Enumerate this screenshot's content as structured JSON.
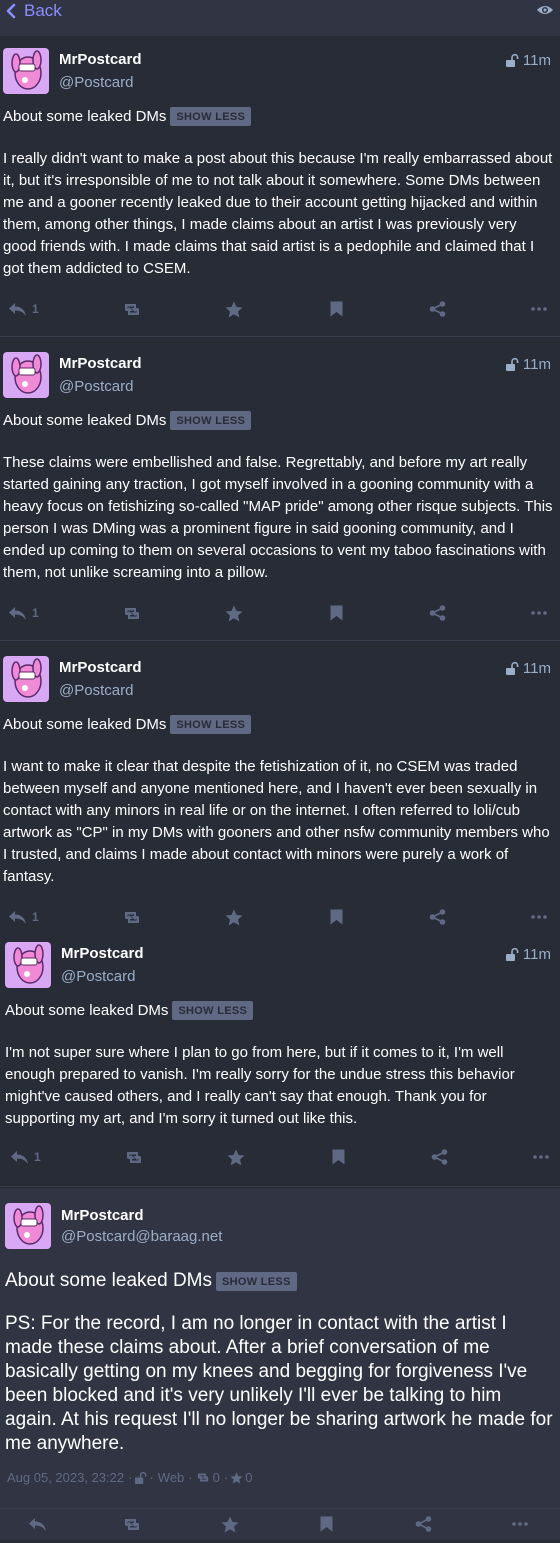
{
  "header": {
    "back_label": "Back"
  },
  "posts": [
    {
      "display_name": "MrPostcard",
      "acct": "@Postcard",
      "time": "11m",
      "cw": "About some leaked DMs",
      "show_less": "SHOW LESS",
      "content": "I really didn't want to make a post about this because I'm really embarrassed about it, but it's irresponsible of me to not talk about it somewhere. Some DMs between me and a gooner recently leaked due to their account getting hijacked and within them, among other things, I made claims about an artist I was previously very good friends with. I made claims that said artist is a pedophile and claimed that I got them addicted to CSEM.",
      "reply_count": "1"
    },
    {
      "display_name": "MrPostcard",
      "acct": "@Postcard",
      "time": "11m",
      "cw": "About some leaked DMs",
      "show_less": "SHOW LESS",
      "content": "These claims were embellished and false. Regrettably, and before my art really started gaining any traction, I got myself involved in a gooning community with a heavy focus on fetishizing so-called \"MAP pride\" among other risque subjects. This person I was DMing was a prominent figure in said gooning community, and I ended up coming to them on several occasions to vent my taboo fascinations with them, not unlike screaming into a pillow.",
      "reply_count": "1"
    },
    {
      "display_name": "MrPostcard",
      "acct": "@Postcard",
      "time": "11m",
      "cw": "About some leaked DMs",
      "show_less": "SHOW LESS",
      "content": "I want to make it clear that despite the fetishization of it, no CSEM was traded between myself and anyone mentioned here, and I haven't ever been sexually in contact with any minors in real life or on the internet. I often referred to loli/cub artwork as \"CP\" in my DMs with gooners and other nsfw community members who I trusted, and claims I made about contact with minors were purely a work of fantasy.",
      "reply_count": "1"
    },
    {
      "display_name": "MrPostcard",
      "acct": "@Postcard",
      "time": "11m",
      "cw": "About some leaked DMs",
      "show_less": "SHOW LESS",
      "content": "I'm not super sure where I plan to go from here, but if it comes to it, I'm well enough prepared to vanish. I'm really sorry for the undue stress this behavior might've caused others, and I really can't say that enough. Thank you for supporting my art, and I'm sorry it turned out like this.",
      "reply_count": "1"
    }
  ],
  "detailed": {
    "display_name": "MrPostcard",
    "acct": "@Postcard@baraag.net",
    "cw": "About some leaked DMs",
    "show_less": "SHOW LESS",
    "content": "PS: For the record, I am no longer in contact with the artist I made these claims about. After a brief conversation of me basically getting on my knees and begging for forgiveness I've been blocked and it's very unlikely I'll ever be talking to him again. At his request I'll no longer be sharing artwork he made for me anywhere.",
    "date": "Aug 05, 2023, 23:22",
    "sep": "·",
    "app": "Web",
    "boosts": "0",
    "favourites": "0"
  },
  "colors": {
    "background": "#282c37",
    "header": "#313543",
    "accent": "#8c8dff",
    "muted": "#9baec8",
    "icon": "#606984",
    "avatar_bg": "#d9a8f4"
  },
  "icons": [
    "chevron-left-icon",
    "eye-icon",
    "unlock-icon",
    "reply-icon",
    "boost-icon",
    "star-icon",
    "bookmark-icon",
    "share-icon",
    "ellipsis-icon"
  ]
}
